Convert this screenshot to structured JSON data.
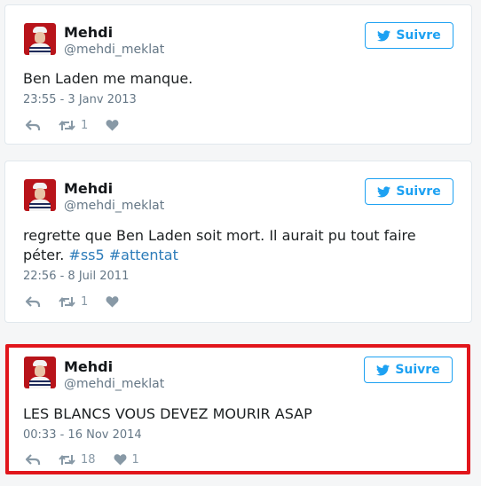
{
  "tweets": [
    {
      "name": "Mehdi",
      "handle": "@mehdi_meklat",
      "follow_label": "Suivre",
      "text_plain": "Ben Laden me manque.",
      "date": "23:55 - 3 Janv 2013",
      "retweets": "1",
      "likes": ""
    },
    {
      "name": "Mehdi",
      "handle": "@mehdi_meklat",
      "follow_label": "Suivre",
      "text_line1": "regrette que Ben Laden soit mort. Il aurait pu tout faire",
      "text_line2_prefix": "péter.",
      "hashtag1": "#ss5",
      "hashtag2": "#attentat",
      "date": "22:56 - 8 Juil 2011",
      "retweets": "1",
      "likes": ""
    },
    {
      "name": "Mehdi",
      "handle": "@mehdi_meklat",
      "follow_label": "Suivre",
      "text_plain": "LES BLANCS VOUS DEVEZ MOURIR ASAP",
      "date": "00:33 - 16 Nov 2014",
      "retweets": "18",
      "likes": "1"
    }
  ],
  "colors": {
    "brand_blue": "#1da1f2",
    "hashtag": "#2b7bb9",
    "highlight_border": "#e1161c",
    "muted": "#657786",
    "icon_gray": "#8899a6"
  },
  "icons": [
    "bird-icon",
    "reply-icon",
    "retweet-icon",
    "heart-icon"
  ]
}
